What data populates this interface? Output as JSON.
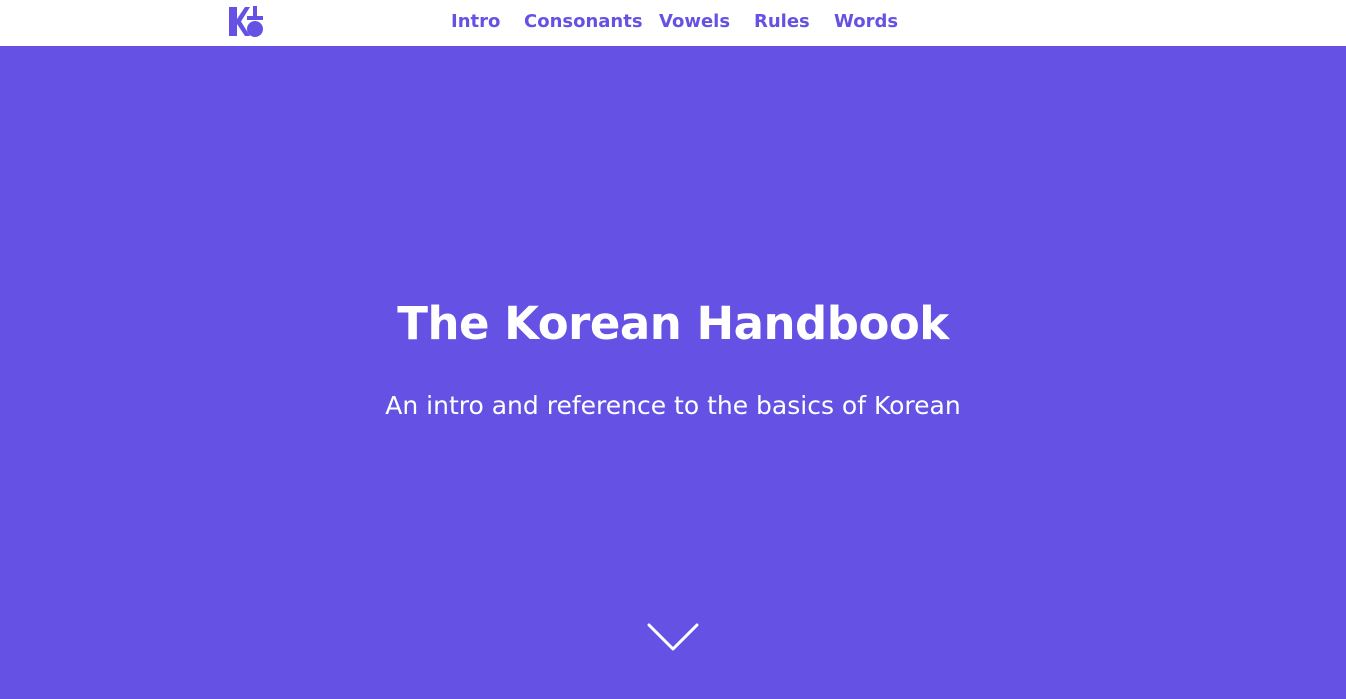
{
  "nav": {
    "logo_icon": "korean-handbook-logo-icon",
    "links": [
      {
        "label": "Intro"
      },
      {
        "label": "Consonants"
      },
      {
        "label": "Vowels"
      },
      {
        "label": "Rules"
      },
      {
        "label": "Words"
      }
    ]
  },
  "hero": {
    "title": "The Korean Handbook",
    "subtitle": "An intro and reference to the basics of Korean",
    "scroll_icon": "chevron-down-icon"
  },
  "colors": {
    "accent": "#6552e4",
    "background_nav": "#ffffff",
    "text_on_accent": "#ffffff"
  }
}
